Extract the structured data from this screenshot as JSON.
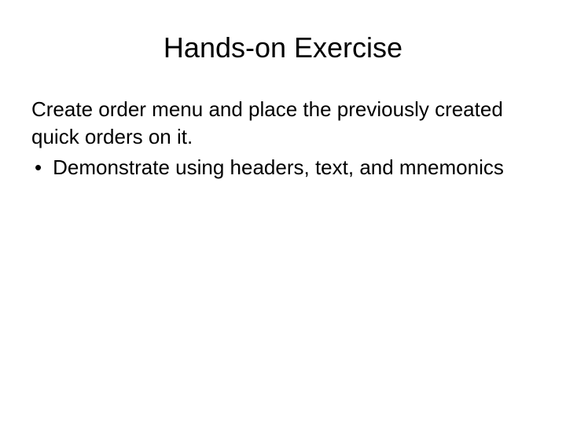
{
  "slide": {
    "title": "Hands-on Exercise",
    "intro": "Create order menu and place the previously created quick orders on it.",
    "bullets": [
      "Demonstrate using headers, text, and mnemonics"
    ]
  }
}
